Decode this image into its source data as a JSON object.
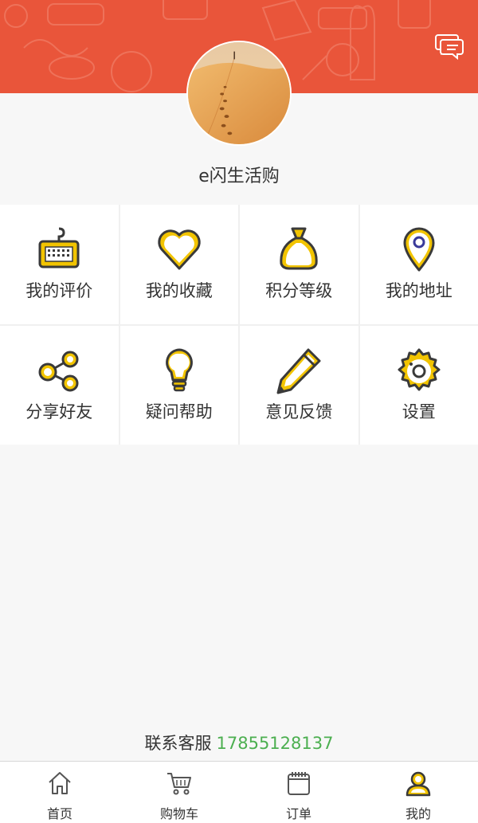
{
  "header": {
    "background_color": "#e9553a",
    "message_icon": "chat-bubbles-icon",
    "avatar_description": "desert-footprints-avatar"
  },
  "profile": {
    "username": "e闪生活购"
  },
  "menu": {
    "accent_color": "#f2c400",
    "items": [
      {
        "label": "我的评价",
        "icon": "keyboard-icon"
      },
      {
        "label": "我的收藏",
        "icon": "heart-icon"
      },
      {
        "label": "积分等级",
        "icon": "money-bag-icon"
      },
      {
        "label": "我的地址",
        "icon": "location-pin-icon"
      },
      {
        "label": "分享好友",
        "icon": "share-icon"
      },
      {
        "label": "疑问帮助",
        "icon": "lightbulb-icon"
      },
      {
        "label": "意见反馈",
        "icon": "pencil-icon"
      },
      {
        "label": "设置",
        "icon": "gear-icon"
      }
    ]
  },
  "contact": {
    "label": "联系客服",
    "phone": "17855128137",
    "phone_color": "#4caf50"
  },
  "tabbar": {
    "active_index": 3,
    "tabs": [
      {
        "label": "首页",
        "icon": "home-icon"
      },
      {
        "label": "购物车",
        "icon": "cart-icon"
      },
      {
        "label": "订单",
        "icon": "calendar-icon"
      },
      {
        "label": "我的",
        "icon": "user-icon"
      }
    ]
  }
}
